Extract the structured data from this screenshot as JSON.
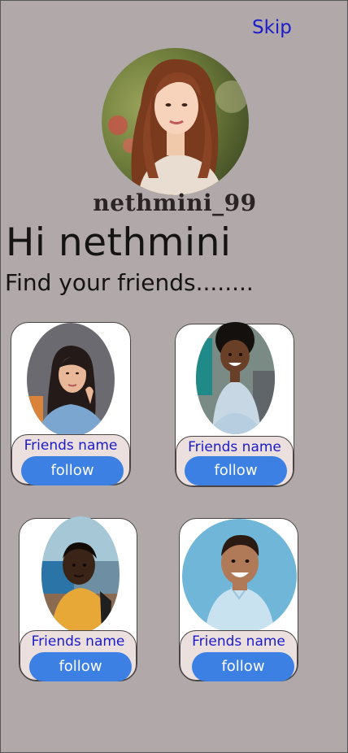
{
  "colors": {
    "background": "#b1a9a9",
    "link": "#1b1bcc",
    "button": "#3b80e2",
    "card_footer": "#ece0de"
  },
  "header": {
    "skip_label": "Skip"
  },
  "profile": {
    "avatar_icon": "woman-portrait",
    "username": "nethmini_99",
    "greeting": "Hi nethmini",
    "subtitle": "Find your friends........"
  },
  "friends": [
    {
      "name": "Friends name",
      "button_label": "follow",
      "photo_icon": "girl-portrait"
    },
    {
      "name": "Friends name",
      "button_label": "follow",
      "photo_icon": "child-girl-portrait"
    },
    {
      "name": "Friends name",
      "button_label": "follow",
      "photo_icon": "boy-portrait"
    },
    {
      "name": "Friends name",
      "button_label": "follow",
      "photo_icon": "smiling-boy-portrait"
    }
  ]
}
